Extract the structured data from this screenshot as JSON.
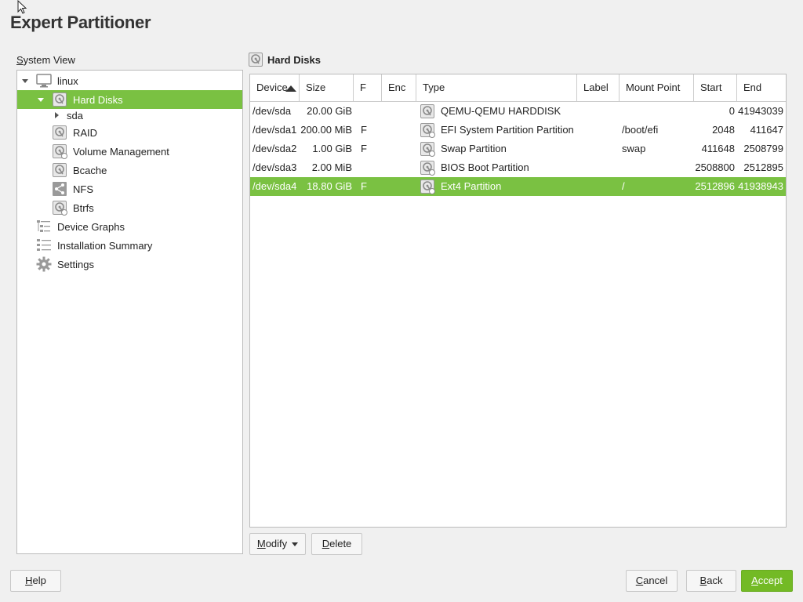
{
  "page": {
    "title": "Expert Partitioner"
  },
  "system_view": {
    "label": "System View",
    "tree": [
      {
        "label": "linux",
        "icon": "computer-icon"
      },
      {
        "label": "Hard Disks",
        "icon": "hard-disk-icon",
        "selected": true
      },
      {
        "label": "sda",
        "icon": ""
      },
      {
        "label": "RAID",
        "icon": "raid-icon"
      },
      {
        "label": "Volume Management",
        "icon": "volume-management-icon"
      },
      {
        "label": "Bcache",
        "icon": "bcache-icon"
      },
      {
        "label": "NFS",
        "icon": "nfs-share-icon"
      },
      {
        "label": "Btrfs",
        "icon": "btrfs-icon"
      },
      {
        "label": "Device Graphs",
        "icon": "device-graphs-icon"
      },
      {
        "label": "Installation Summary",
        "icon": "list-icon"
      },
      {
        "label": "Settings",
        "icon": "gear-icon"
      }
    ]
  },
  "panel": {
    "title": "Hard Disks"
  },
  "table": {
    "columns": [
      "Device",
      "Size",
      "F",
      "Enc",
      "Type",
      "Label",
      "Mount Point",
      "Start",
      "End"
    ],
    "rows": [
      {
        "device": "/dev/sda",
        "size": "20.00 GiB",
        "f": "",
        "enc": "",
        "type": "QEMU-QEMU HARDDISK",
        "label": "",
        "mount": "",
        "start": "0",
        "end": "41943039"
      },
      {
        "device": "/dev/sda1",
        "size": "200.00 MiB",
        "f": "F",
        "enc": "",
        "type": "EFI System Partition Partition",
        "label": "",
        "mount": "/boot/efi",
        "start": "2048",
        "end": "411647"
      },
      {
        "device": "/dev/sda2",
        "size": "1.00 GiB",
        "f": "F",
        "enc": "",
        "type": "Swap Partition",
        "label": "",
        "mount": "swap",
        "start": "411648",
        "end": "2508799"
      },
      {
        "device": "/dev/sda3",
        "size": "2.00 MiB",
        "f": "",
        "enc": "",
        "type": "BIOS Boot Partition",
        "label": "",
        "mount": "",
        "start": "2508800",
        "end": "2512895"
      },
      {
        "device": "/dev/sda4",
        "size": "18.80 GiB",
        "f": "F",
        "enc": "",
        "type": "Ext4 Partition",
        "label": "",
        "mount": "/",
        "start": "2512896",
        "end": "41938943",
        "selected": true
      }
    ]
  },
  "buttons": {
    "modify": "Modify",
    "delete": "Delete",
    "help": "Help",
    "cancel": "Cancel",
    "back": "Back",
    "accept": "Accept"
  },
  "colors": {
    "accent": "#7ac142"
  }
}
